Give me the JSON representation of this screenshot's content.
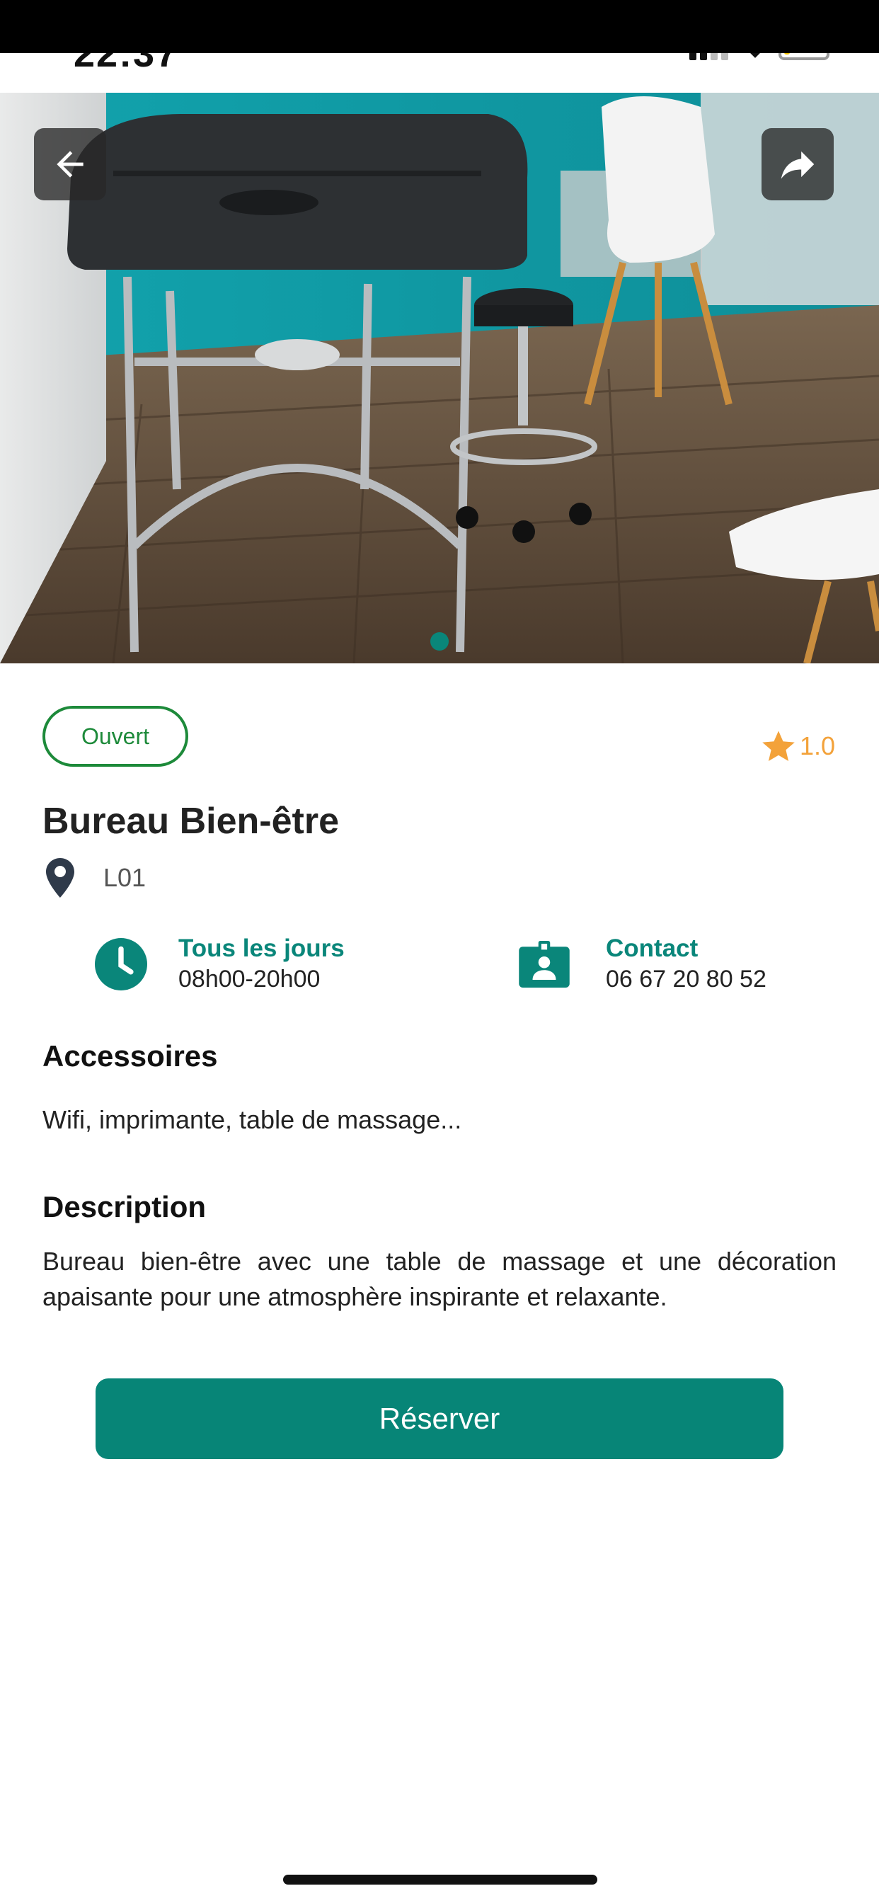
{
  "status": {
    "time": "22:37"
  },
  "hero": {
    "image_alt": "Massage room with massage table, stool and chairs",
    "active_slide": 1,
    "total_slides": 1
  },
  "badge": "Ouvert",
  "rating": "1.0",
  "title": "Bureau Bien-être",
  "location": "L01",
  "hours": {
    "label": "Tous les jours",
    "value": "08h00-20h00"
  },
  "contact": {
    "label": "Contact",
    "value": "06 67 20 80 52"
  },
  "accessories": {
    "title": "Accessoires",
    "text": "Wifi, imprimante, table de massage..."
  },
  "description": {
    "title": "Description",
    "text": "Bureau bien-être avec une table de massage et une décoration apaisante pour une atmosphère inspirante et relaxante."
  },
  "reserve_label": "Réserver",
  "colors": {
    "accent": "#078577",
    "open": "#1d8a3a",
    "star": "#f3a23a"
  },
  "icons": [
    "back-arrow-icon",
    "share-icon",
    "star-icon",
    "location-pin-icon",
    "clock-icon",
    "contact-badge-icon"
  ]
}
